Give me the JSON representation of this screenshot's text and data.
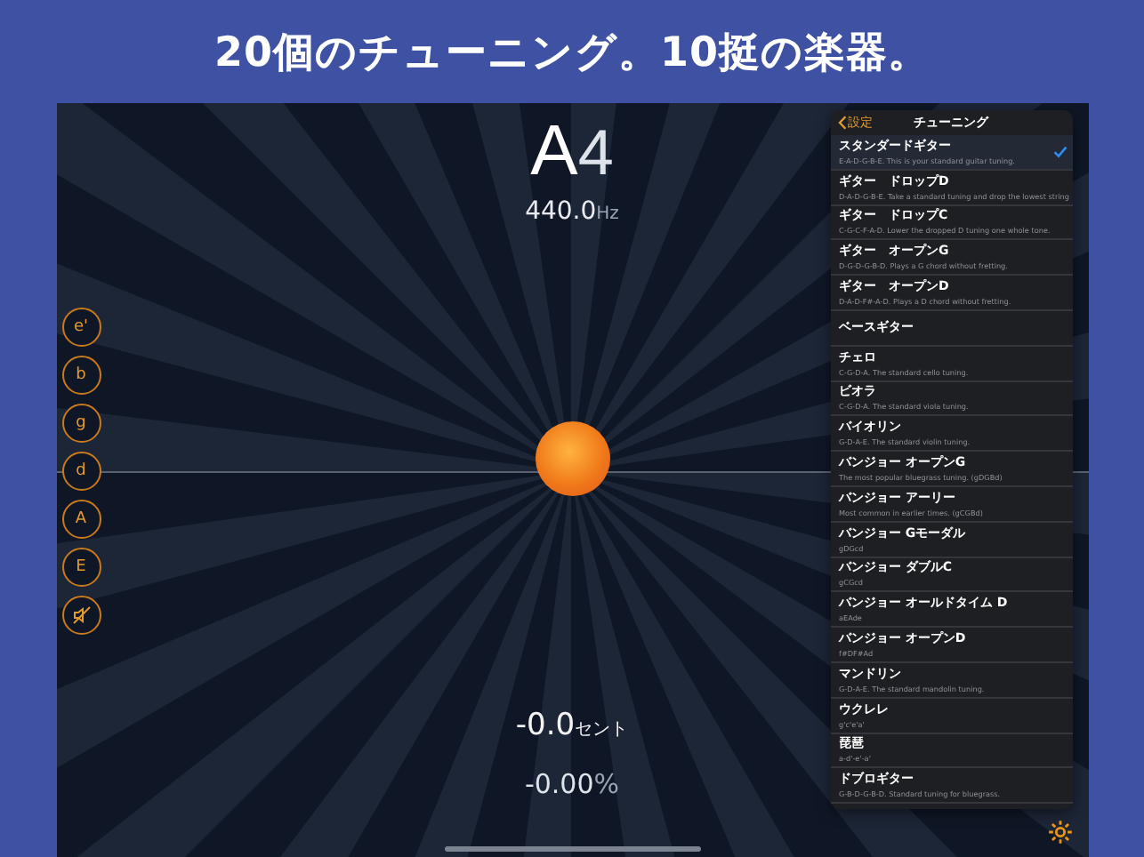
{
  "headline": "20個のチューニング。10挺の楽器。",
  "tuner": {
    "note": "A",
    "octave": "4",
    "frequency": "440.0",
    "frequency_unit": "Hz",
    "cents": "-0.0",
    "cents_unit": "セント",
    "percent": "-0.00",
    "percent_unit": "%"
  },
  "strings": [
    {
      "kind": "note",
      "label": "e'"
    },
    {
      "kind": "note",
      "label": "b"
    },
    {
      "kind": "note",
      "label": "g"
    },
    {
      "kind": "note",
      "label": "d"
    },
    {
      "kind": "note",
      "label": "A"
    },
    {
      "kind": "note",
      "label": "E"
    },
    {
      "kind": "mute"
    }
  ],
  "popover": {
    "back": "設定",
    "title": "チューニング",
    "items": [
      {
        "name": "スタンダードギター",
        "description": "E-A-D-G-B-E. This is your standard guitar tuning.",
        "selected": true
      },
      {
        "name": "ギター　ドロップD",
        "description": "D-A-D-G-B-E. Take a standard tuning and drop the lowest string",
        "selected": false
      },
      {
        "name": "ギター　ドロップC",
        "description": "C-G-C-F-A-D. Lower the dropped D tuning one whole tone.",
        "selected": false
      },
      {
        "name": "ギター　オープンG",
        "description": "D-G-D-G-B-D. Plays a G chord without fretting.",
        "selected": false
      },
      {
        "name": "ギター　オープンD",
        "description": "D-A-D-F#-A-D. Plays a D chord without fretting.",
        "selected": false
      },
      {
        "name": "ベースギター",
        "selected": false
      },
      {
        "name": "チェロ",
        "description": "C-G-D-A. The standard cello tuning.",
        "selected": false
      },
      {
        "name": "ビオラ",
        "description": "C-G-D-A. The standard viola tuning.",
        "selected": false
      },
      {
        "name": "バイオリン",
        "description": "G-D-A-E. The standard violin tuning.",
        "selected": false
      },
      {
        "name": "バンジョー オープンG",
        "description": "The most popular bluegrass tuning. (gDGBd)",
        "selected": false
      },
      {
        "name": "バンジョー アーリー",
        "description": "Most common in earlier times. (gCGBd)",
        "selected": false
      },
      {
        "name": "バンジョー Gモーダル",
        "description": "gDGcd",
        "selected": false
      },
      {
        "name": "バンジョー ダブルC",
        "description": "gCGcd",
        "selected": false
      },
      {
        "name": "バンジョー オールドタイム D",
        "description": "aEAde",
        "selected": false
      },
      {
        "name": "バンジョー オープンD",
        "description": "f#DF#Ad",
        "selected": false
      },
      {
        "name": "マンドリン",
        "description": "G-D-A-E. The standard mandolin tuning.",
        "selected": false
      },
      {
        "name": "ウクレレ",
        "description": "g'c'e'a'",
        "selected": false
      },
      {
        "name": "琵琶",
        "description": "a-d'-e'-a'",
        "selected": false
      },
      {
        "name": "ドブロギター",
        "description": "G-B-D-G-B-D. Standard tuning for bluegrass.",
        "selected": false
      }
    ]
  }
}
